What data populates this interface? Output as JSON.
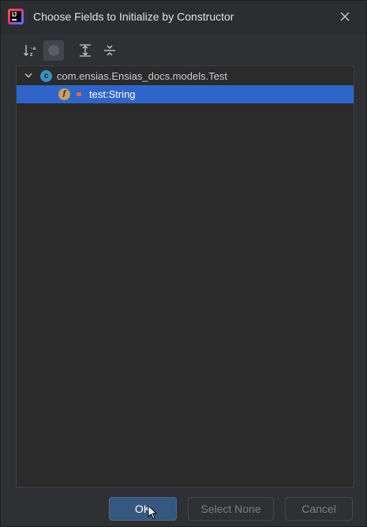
{
  "window": {
    "title": "Choose Fields to Initialize by Constructor",
    "app_icon": "intellij-idea-icon",
    "close_icon": "close-icon"
  },
  "toolbar": {
    "buttons": [
      {
        "icon": "sort-alphabetically-icon",
        "pressed": false
      },
      {
        "icon": "show-inherited-icon",
        "pressed": true
      },
      {
        "icon": "expand-all-icon",
        "pressed": false
      },
      {
        "icon": "collapse-all-icon",
        "pressed": false
      }
    ]
  },
  "tree": {
    "root": {
      "label": "com.ensias.Ensias_docs.models.Test",
      "icon": "class-icon",
      "icon_letter": "c",
      "expanded": true
    },
    "fields": [
      {
        "label": "test:String",
        "icon": "field-icon",
        "icon_letter": "f",
        "visibility_icon": "private-lock-icon",
        "selected": true
      }
    ]
  },
  "footer": {
    "ok_label": "OK",
    "select_none_label": "Select None",
    "cancel_label": "Cancel"
  },
  "colors": {
    "selection": "#2f65ca",
    "background": "#2b2b2b",
    "ok_button": "#365880",
    "class_icon": "#3592c4",
    "field_icon": "#c9a15f"
  }
}
